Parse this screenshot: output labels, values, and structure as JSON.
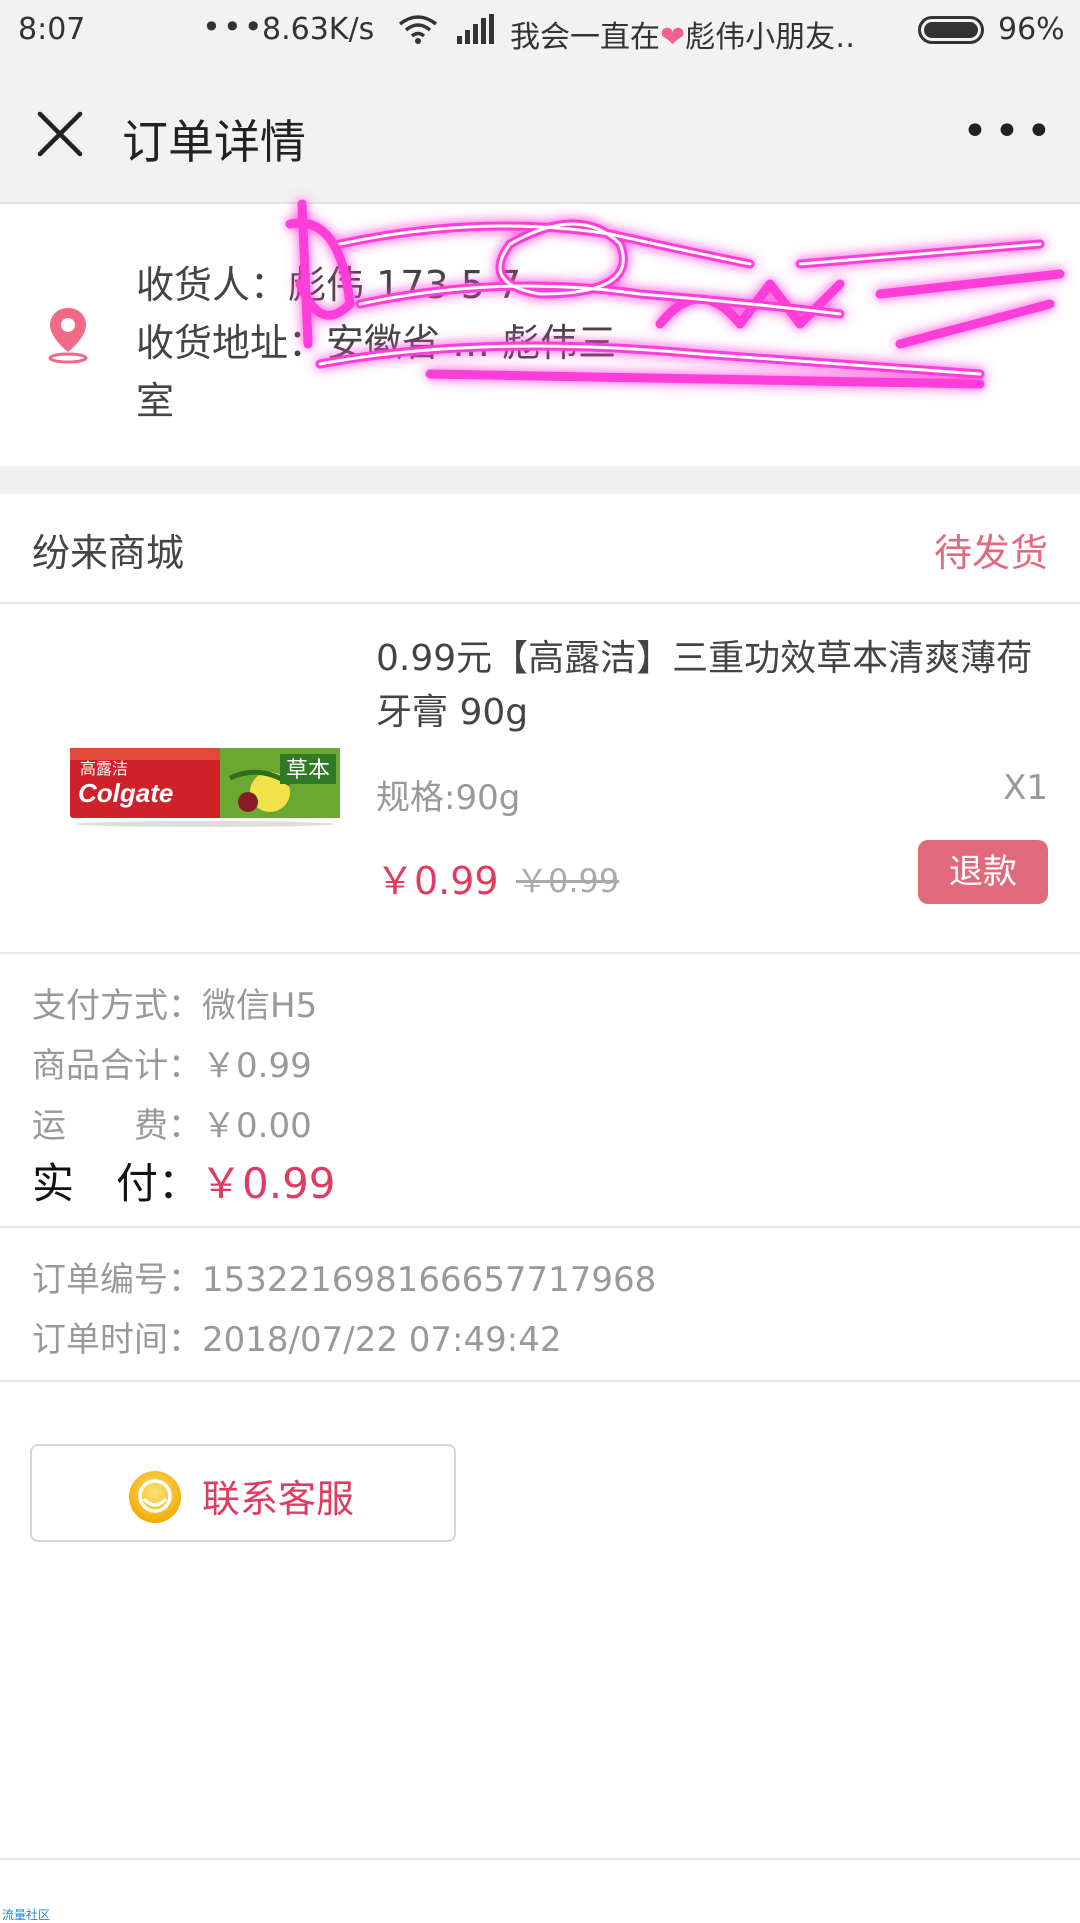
{
  "status_bar": {
    "time": "8:07",
    "dots": "•••",
    "speed": "8.63K/s",
    "carrier": "我会一直在",
    "carrier_heart": "❤",
    "carrier_tail": "彪伟小朋友‥",
    "battery": "96%"
  },
  "nav": {
    "title": "订单详情",
    "more": "•••"
  },
  "address": {
    "receiver_label": "收货人：",
    "receiver_value": "彪伟 173 5 7",
    "address_label": "收货地址：",
    "address_value": "安徽省 … 彪伟三",
    "address_tail": "室"
  },
  "shop": {
    "name": "纷来商城",
    "status": "待发货"
  },
  "product": {
    "name": "0.99元【高露洁】三重功效草本清爽薄荷牙膏 90g",
    "spec": "规格:90g",
    "qty": "X1",
    "price": "￥0.99",
    "old_price": "￥0.99",
    "refund": "退款",
    "image_brand": "Colgate",
    "image_cn": "高露洁",
    "image_tag": "草本"
  },
  "summary": {
    "payment": "支付方式：微信H5",
    "subtotal": "商品合计：￥0.99",
    "shipping": "运　　费：￥0.00",
    "paid_label": "实　付：",
    "paid_value": "￥0.99"
  },
  "order": {
    "number": "订单编号：153221698166657717968",
    "time": "订单时间：2018/07/22 07:49:42"
  },
  "contact": {
    "label": "联系客服"
  },
  "footer": {
    "mark": "流量社区"
  },
  "colors": {
    "accent": "#e03c62",
    "status": "#e26a7e",
    "refund_bg": "#e0697c",
    "scribble": "#ff3ed8"
  }
}
